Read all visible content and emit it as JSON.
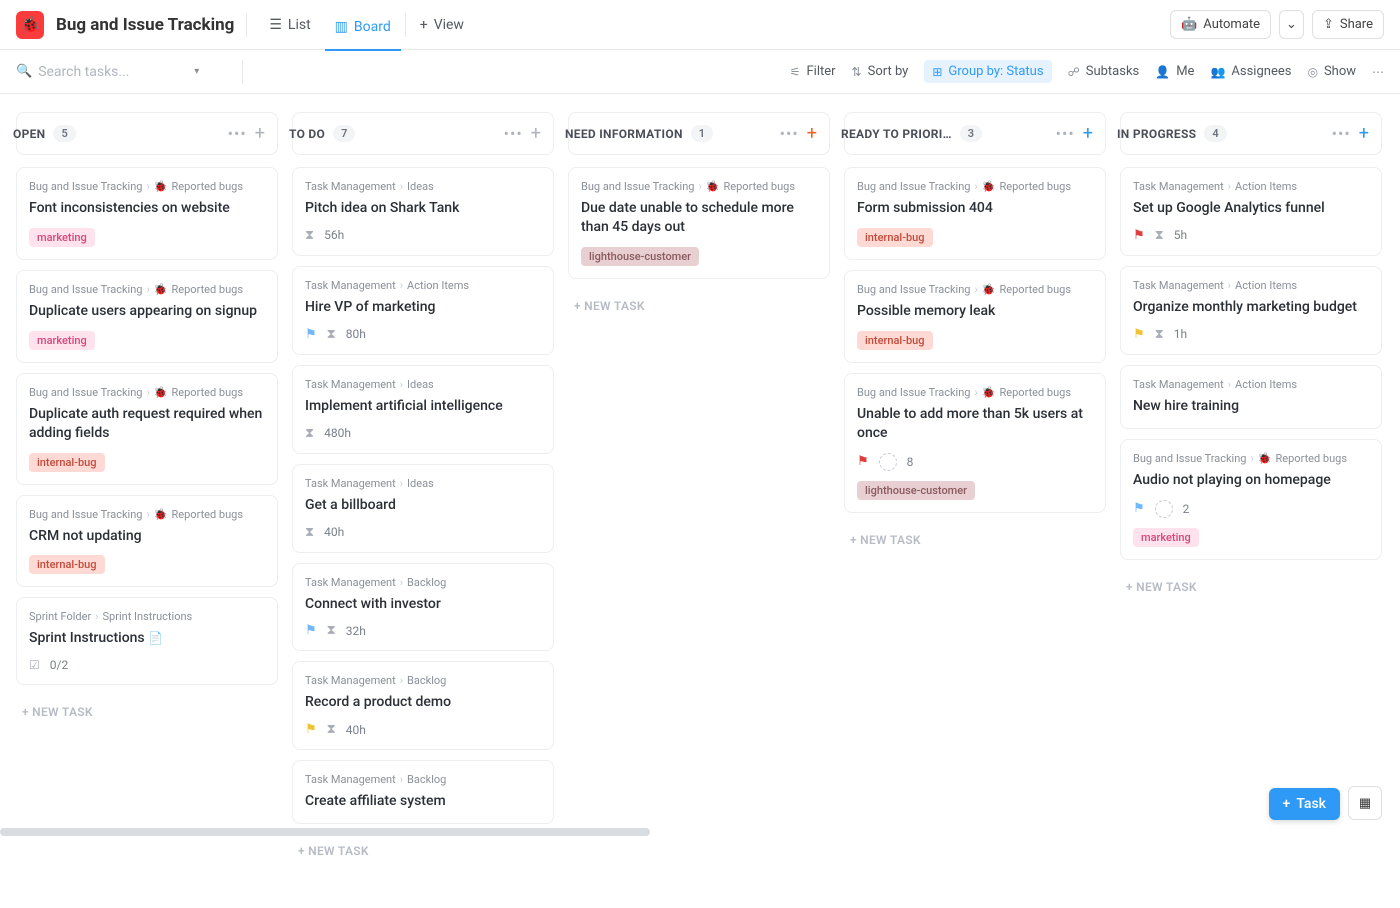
{
  "app": {
    "title": "Bug and Issue Tracking"
  },
  "views": {
    "list": "List",
    "board": "Board",
    "add": "View"
  },
  "topButtons": {
    "automate": "Automate",
    "share": "Share"
  },
  "search": {
    "placeholder": "Search tasks..."
  },
  "toolbar": {
    "filter": "Filter",
    "sortby": "Sort by",
    "groupby": "Group by: Status",
    "subtasks": "Subtasks",
    "me": "Me",
    "assignees": "Assignees",
    "show": "Show"
  },
  "labels": {
    "newTask": "+ NEW TASK",
    "floatingTask": "Task"
  },
  "columns": [
    {
      "title": "OPEN",
      "count": "5",
      "accent": "#b0b5bd",
      "add_class": "",
      "cards": [
        {
          "crumb1": "Bug and Issue Tracking",
          "crumb2": "Reported bugs",
          "bug": true,
          "title": "Font inconsistencies on website",
          "tags": [
            {
              "text": "marketing",
              "cls": "tag-marketing"
            }
          ]
        },
        {
          "crumb1": "Bug and Issue Tracking",
          "crumb2": "Reported bugs",
          "bug": true,
          "title": "Duplicate users appearing on signup",
          "tags": [
            {
              "text": "marketing",
              "cls": "tag-marketing"
            }
          ]
        },
        {
          "crumb1": "Bug and Issue Tracking",
          "crumb2": "Reported bugs",
          "bug": true,
          "title": "Duplicate auth request required when adding fields",
          "tags": [
            {
              "text": "internal-bug",
              "cls": "tag-internal-bug"
            }
          ]
        },
        {
          "crumb1": "Bug and Issue Tracking",
          "crumb2": "Reported bugs",
          "bug": true,
          "title": "CRM not updating",
          "tags": [
            {
              "text": "internal-bug",
              "cls": "tag-internal-bug"
            }
          ]
        },
        {
          "crumb1": "Sprint Folder",
          "crumb2": "Sprint Instructions",
          "bug": false,
          "title": "Sprint Instructions",
          "doc": true,
          "checklist": "0/2"
        }
      ]
    },
    {
      "title": "TO DO",
      "count": "7",
      "accent": "#b0b5bd",
      "add_class": "",
      "cards": [
        {
          "crumb1": "Task Management",
          "crumb2": "Ideas",
          "bug": false,
          "title": "Pitch idea on Shark Tank",
          "time": "56h"
        },
        {
          "crumb1": "Task Management",
          "crumb2": "Action Items",
          "bug": false,
          "title": "Hire VP of marketing",
          "flag": "blue",
          "time": "80h"
        },
        {
          "crumb1": "Task Management",
          "crumb2": "Ideas",
          "bug": false,
          "title": "Implement artificial intelligence",
          "time": "480h"
        },
        {
          "crumb1": "Task Management",
          "crumb2": "Ideas",
          "bug": false,
          "title": "Get a billboard",
          "time": "40h"
        },
        {
          "crumb1": "Task Management",
          "crumb2": "Backlog",
          "bug": false,
          "title": "Connect with investor",
          "flag": "blue",
          "time": "32h"
        },
        {
          "crumb1": "Task Management",
          "crumb2": "Backlog",
          "bug": false,
          "title": "Record a product demo",
          "flag": "yellow",
          "time": "40h"
        },
        {
          "crumb1": "Task Management",
          "crumb2": "Backlog",
          "bug": false,
          "title": "Create affiliate system"
        }
      ]
    },
    {
      "title": "NEED INFORMATION",
      "count": "1",
      "accent": "#f26522",
      "add_class": "orange",
      "cards": [
        {
          "crumb1": "Bug and Issue Tracking",
          "crumb2": "Reported bugs",
          "bug": true,
          "title": "Due date unable to schedule more than 45 days out",
          "tags": [
            {
              "text": "lighthouse-customer",
              "cls": "tag-lighthouse"
            }
          ]
        }
      ]
    },
    {
      "title": "READY TO PRIORI…",
      "count": "3",
      "accent": "#2f9af5",
      "add_class": "blue",
      "cards": [
        {
          "crumb1": "Bug and Issue Tracking",
          "crumb2": "Reported bugs",
          "bug": true,
          "title": "Form submission 404",
          "tags": [
            {
              "text": "internal-bug",
              "cls": "tag-internal-bug"
            }
          ]
        },
        {
          "crumb1": "Bug and Issue Tracking",
          "crumb2": "Reported bugs",
          "bug": true,
          "title": "Possible memory leak",
          "tags": [
            {
              "text": "internal-bug",
              "cls": "tag-internal-bug"
            }
          ]
        },
        {
          "crumb1": "Bug and Issue Tracking",
          "crumb2": "Reported bugs",
          "bug": true,
          "title": "Unable to add more than 5k users at once",
          "flag": "red",
          "assignee_dashed": true,
          "subcount": "8",
          "tags": [
            {
              "text": "lighthouse-customer",
              "cls": "tag-lighthouse"
            }
          ]
        }
      ]
    },
    {
      "title": "IN PROGRESS",
      "count": "4",
      "accent": "#2f9af5",
      "add_class": "blue",
      "cards": [
        {
          "crumb1": "Task Management",
          "crumb2": "Action Items",
          "bug": false,
          "title": "Set up Google Analytics funnel",
          "flag": "red",
          "time": "5h"
        },
        {
          "crumb1": "Task Management",
          "crumb2": "Action Items",
          "bug": false,
          "title": "Organize monthly marketing budget",
          "flag": "yellow",
          "time": "1h"
        },
        {
          "crumb1": "Task Management",
          "crumb2": "Action Items",
          "bug": false,
          "title": "New hire training"
        },
        {
          "crumb1": "Bug and Issue Tracking",
          "crumb2": "Reported bugs",
          "bug": true,
          "title": "Audio not playing on homepage",
          "flag": "blue",
          "assignee_dashed": true,
          "subcount": "2",
          "tags": [
            {
              "text": "marketing",
              "cls": "tag-marketing"
            }
          ]
        }
      ]
    }
  ]
}
